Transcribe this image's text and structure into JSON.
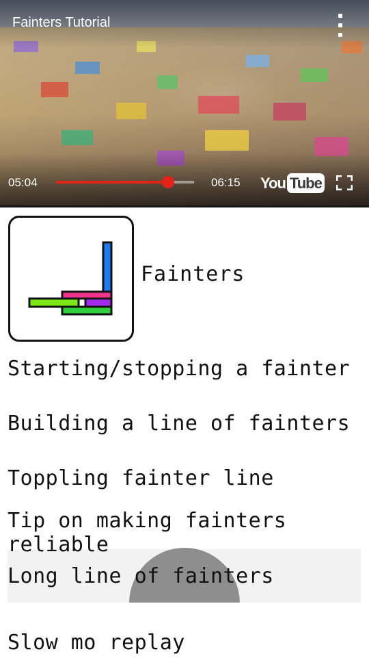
{
  "video": {
    "title": "Fainters Tutorial",
    "current_time": "05:04",
    "total_time": "06:15",
    "progress_fraction": 0.81,
    "logo_you": "You",
    "logo_tube": "Tube"
  },
  "section": {
    "heading": "Fainters"
  },
  "chapters": [
    "Starting/stopping a fainter",
    "Building a line of fainters",
    "Toppling fainter line",
    "Tip on making fainters reliable",
    "Long line of fainters",
    "Slow mo replay"
  ],
  "colors": {
    "seek_red": "#e62117",
    "highlight_bg": "#f2f2f2",
    "ripple": "#8e8e8e",
    "icon_blue": "#1e7cf2",
    "icon_pink": "#f2338c",
    "icon_lime": "#7ee817",
    "icon_purple": "#a12cf0",
    "icon_green": "#2ed13c"
  }
}
